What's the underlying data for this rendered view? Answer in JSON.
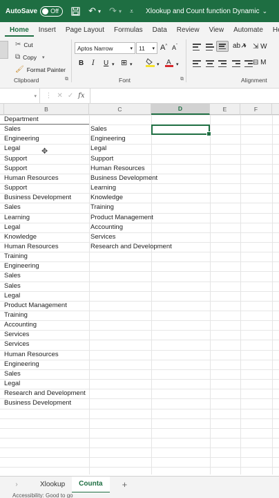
{
  "titlebar": {
    "autosave_label": "AutoSave",
    "toggle_state": "Off",
    "document_title": "Xlookup and Count function Dynamic",
    "brand_color": "#1e6e42"
  },
  "tabs": [
    "Home",
    "Insert",
    "Page Layout",
    "Formulas",
    "Data",
    "Review",
    "View",
    "Automate",
    "Help"
  ],
  "active_tab": "Home",
  "ribbon": {
    "clipboard": {
      "cut": "Cut",
      "copy": "Copy",
      "format_painter": "Format Painter",
      "label": "Clipboard"
    },
    "font": {
      "name": "Aptos Narrow",
      "size": "11",
      "label": "Font",
      "bold": "B",
      "italic": "I",
      "underline": "U"
    },
    "alignment": {
      "label": "Alignment",
      "wrap": "W",
      "merge": "M"
    }
  },
  "formula_bar": {
    "fx": "fx"
  },
  "columns": [
    "B",
    "C",
    "D",
    "E",
    "F"
  ],
  "selected_column": "D",
  "column_b": [
    "Department",
    "Sales",
    "Engineering",
    "Legal",
    "Support",
    "Support",
    "Human Resources",
    "Support",
    "Business Development",
    "Sales",
    "Learning",
    "Legal",
    "Knowledge",
    "Human Resources",
    "Training",
    "Engineering",
    "Sales",
    "Sales",
    "Legal",
    "Product Management",
    "Training",
    "Accounting",
    "Services",
    "Services",
    "Human Resources",
    "Engineering",
    "Sales",
    "Legal",
    "Research and Development",
    "Business Development"
  ],
  "column_c": [
    "Sales",
    "Engineering",
    "Legal",
    "Support",
    "Human Resources",
    "Business Development",
    "Learning",
    "Knowledge",
    "Training",
    "Product Management",
    "Accounting",
    "Services",
    "Research and Development"
  ],
  "sheets": [
    "Xlookup",
    "Counta"
  ],
  "active_sheet": "Counta",
  "status": "Accessibility: Good to go"
}
